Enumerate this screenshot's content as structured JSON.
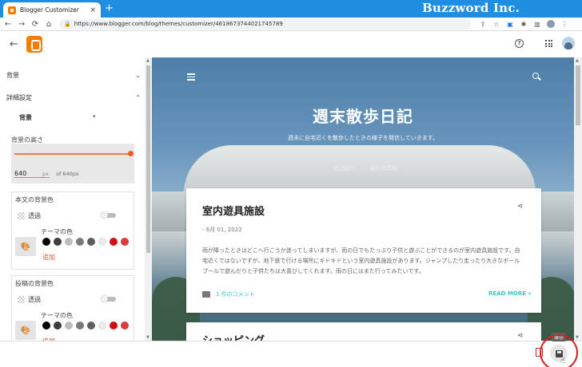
{
  "browser": {
    "tab_title": "Blogger Customizer",
    "tab_close": "×",
    "new_tab": "+",
    "url": "https://www.blogger.com/blog/themes/customizer/4618673744021745789",
    "watermark": "Buzzword Inc."
  },
  "sidebar": {
    "sections": [
      {
        "label": "背景"
      },
      {
        "label": "詳細設定"
      }
    ],
    "sub_select": "背景",
    "height_label": "背景の高さ",
    "height_value": "640",
    "height_unit": "px",
    "height_of": "of 640px",
    "height_fraction": 1.0,
    "cards": [
      {
        "title": "本文の背景色",
        "transparent_label": "透過",
        "theme_label": "テーマの色",
        "add_label": "追加"
      },
      {
        "title": "投稿の背景色",
        "transparent_label": "透過",
        "theme_label": "テーマの色",
        "add_label": "追加"
      }
    ],
    "swatch_colors": [
      "#000000",
      "#3c3c3c",
      "#bdbdbd",
      "#7a7a7a",
      "#5e5e5e",
      "#ececec",
      "#d01010",
      "#e03a3a"
    ]
  },
  "preview": {
    "blog_title": "週末散歩日記",
    "blog_desc": "週末に自宅近くを散歩したときの様子を発信していきます。",
    "nav": [
      "自己紹介",
      "運営者情報"
    ],
    "post": {
      "title": "室内遊具施設",
      "date": "- 6月 01, 2022",
      "body": "雨が降ったときはどこへ行こうか迷ってしまいますが、雨の日でもたっぷり子供と遊ぶことができるのが室内遊具施設です。自宅近くではないですが、地下鉄で行ける場所にキドキドという室内遊具施設があります。ジャンプしたり走ったり大きなボールプールで遊んだりと子供たちは大喜びしてくれます。雨の日にはまた行ってみたいです。",
      "comments": "1 件のコメント",
      "read_more": "READ MORE »"
    },
    "post2_title": "ショッピング"
  },
  "bottom": {
    "save_tooltip": "保存"
  },
  "colors": {
    "accent": "#f57d00",
    "slider": "#ef7b50",
    "link": "#3cc6c0",
    "titlebar": "#1f8ee0"
  }
}
